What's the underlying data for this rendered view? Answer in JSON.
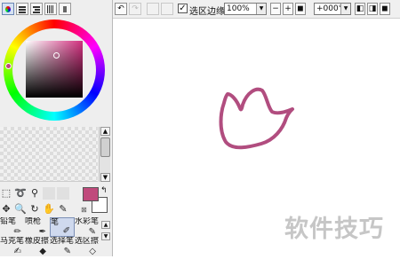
{
  "left_panel": {
    "mode_buttons": [
      "color-wheel-mode-icon",
      "rgb-sliders-icon",
      "hsv-sliders-icon",
      "palette-bar-icon",
      "swatch-icon"
    ],
    "colors": {
      "foreground": "#c04a7c",
      "background": "#ffffff"
    },
    "brushes": [
      {
        "label": "铅笔",
        "icon": "pencil-icon"
      },
      {
        "label": "喷枪",
        "icon": "airbrush-icon"
      },
      {
        "label": "笔",
        "icon": "pen-icon",
        "selected": true
      },
      {
        "label": "水彩笔",
        "icon": "watercolor-icon"
      },
      {
        "label": "马克笔",
        "icon": "marker-icon"
      },
      {
        "label": "橡皮擦",
        "icon": "eraser-icon"
      },
      {
        "label": "选择笔",
        "icon": "select-pen-icon"
      },
      {
        "label": "选区擦",
        "icon": "select-eraser-icon"
      }
    ]
  },
  "toolbar": {
    "undo": "↶",
    "redo": "↷",
    "selection_edge_label": "选区边缘",
    "selection_edge_checked": "✓",
    "zoom_value": "100%",
    "zoom_minus": "−",
    "zoom_plus": "+",
    "rotate_value": "+000°"
  },
  "watermark": "软件技巧"
}
